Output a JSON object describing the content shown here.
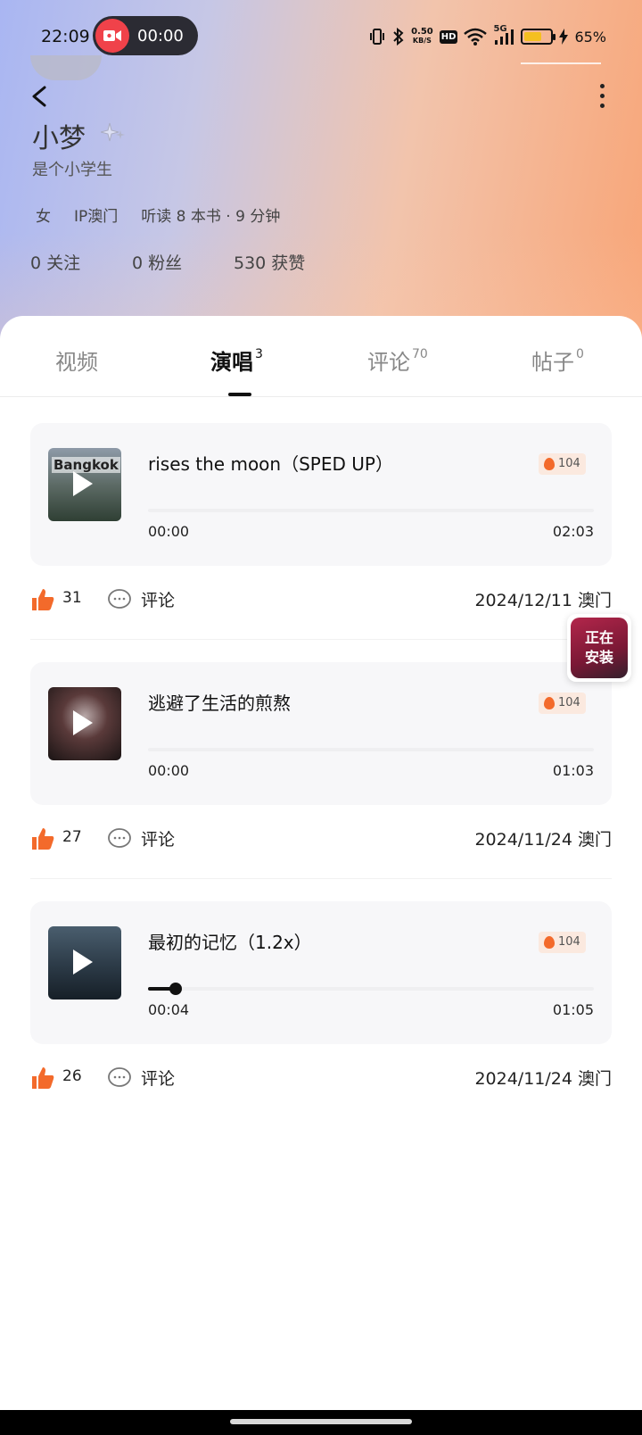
{
  "status_bar": {
    "time": "22:09",
    "recording_time": "00:00",
    "net_speed_value": "0.50",
    "net_speed_unit": "KB/S",
    "hd_label": "HD",
    "network_label": "5G",
    "battery_percent": "65%",
    "battery_level": 0.65
  },
  "profile": {
    "name": "小梦",
    "bio": "是个小学生",
    "tags": [
      "女",
      "IP澳门",
      "听读 8 本书 · 9 分钟"
    ],
    "stats": {
      "following": "0 关注",
      "followers": "0 粉丝",
      "likes": "530 获赞"
    }
  },
  "tabs": [
    {
      "label": "视频",
      "count": ""
    },
    {
      "label": "演唱",
      "count": "3"
    },
    {
      "label": "评论",
      "count": "70"
    },
    {
      "label": "帖子",
      "count": "0"
    }
  ],
  "active_tab": "演唱",
  "songs": [
    {
      "title": "rises the moon（SPED UP）",
      "cover_text": "Bangkok",
      "heat": "104",
      "current_time": "00:00",
      "total_time": "02:03",
      "progress": 0,
      "likes": "31",
      "comment_label": "评论",
      "meta": "2024/12/11 澳门"
    },
    {
      "title": "逃避了生活的煎熬",
      "cover_text": "",
      "heat": "104",
      "current_time": "00:00",
      "total_time": "01:03",
      "progress": 0,
      "likes": "27",
      "comment_label": "评论",
      "meta": "2024/11/24 澳门"
    },
    {
      "title": "最初的记忆（1.2x）",
      "cover_text": "",
      "heat": "104",
      "current_time": "00:04",
      "total_time": "01:05",
      "progress": 0.062,
      "likes": "26",
      "comment_label": "评论",
      "meta": "2024/11/24 澳门"
    }
  ],
  "floating_install": {
    "line1": "正在",
    "line2": "安装"
  },
  "colors": {
    "accent": "#f36a2b",
    "recording": "#f0424a"
  }
}
